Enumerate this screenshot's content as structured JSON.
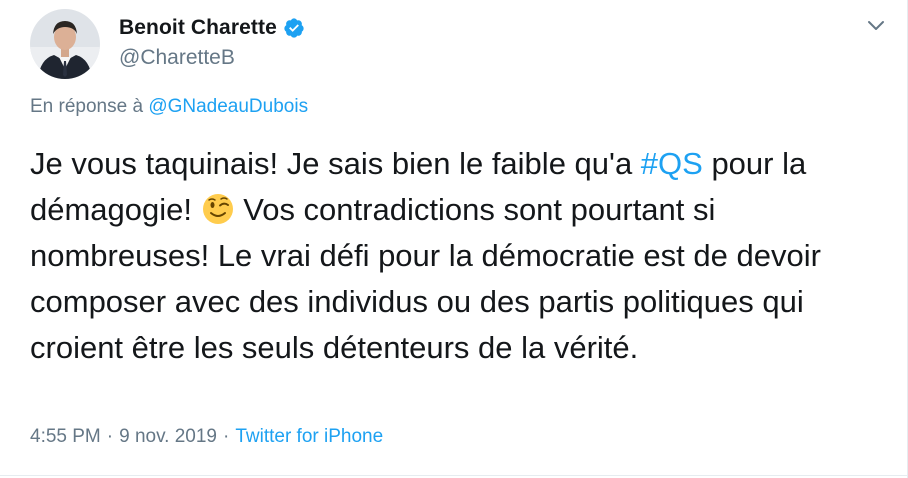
{
  "author": {
    "display_name": "Benoit Charette",
    "handle": "@CharetteB",
    "verified": true,
    "avatar_icon": "profile-photo"
  },
  "reply": {
    "prefix": "En réponse à",
    "mention": "@GNadeauDubois"
  },
  "tweet": {
    "text_1": "Je vous taquinais!  Je sais bien le faible qu'a ",
    "hashtag": "#QS",
    "text_2": " pour la démagogie! ",
    "emoji_icon": "winking-face-emoji",
    "text_3": " Vos contradictions sont pourtant si nombreuses!  Le vrai défi pour la démocratie est de devoir composer avec des individus ou des partis politiques qui croient être les seuls détenteurs de la vérité."
  },
  "meta": {
    "time": "4:55 PM",
    "separator": "·",
    "date": "9 nov. 2019",
    "source": "Twitter for iPhone"
  },
  "colors": {
    "accent": "#1da1f2",
    "muted": "#657786",
    "text": "#14171a"
  }
}
